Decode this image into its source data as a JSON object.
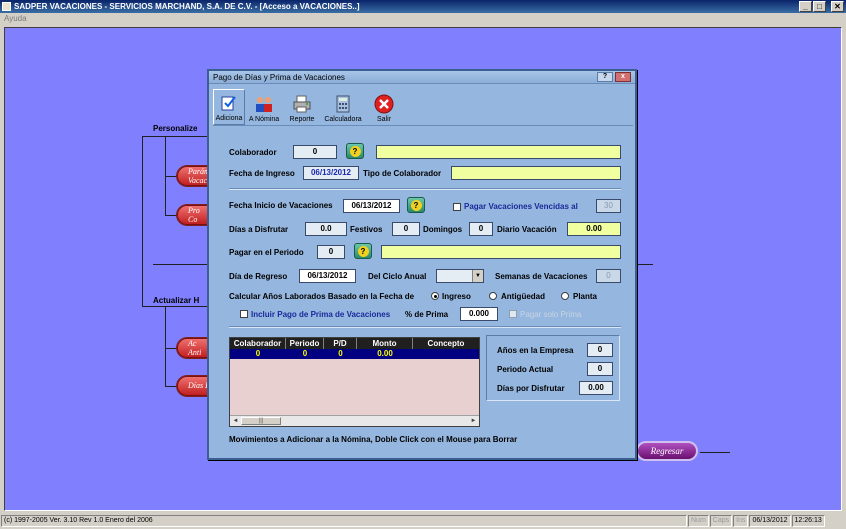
{
  "window": {
    "title": "SADPER VACACIONES  -  SERVICIOS MARCHAND, S.A. DE C.V.  -  [Acceso a VACACIONES..]",
    "min": "_",
    "max": "□",
    "close": "✕"
  },
  "menu": {
    "ayuda": "Ayuda"
  },
  "background": {
    "personalize_label": "Personalize",
    "actualizar_label": "Actualizar H",
    "pills": [
      {
        "line1": "Parám",
        "line2": "Vacac"
      },
      {
        "line1": "Pro",
        "line2": "Co"
      },
      {
        "line1": "Ac",
        "line2": "Anti"
      },
      {
        "line1": "Días D",
        "line2": ""
      }
    ],
    "regresar": "Regresar"
  },
  "dialog": {
    "title": "Pago de Días y Prima de Vacaciones",
    "help_btn": "?",
    "close_btn": "x",
    "toolbar": {
      "adiciona": "Adiciona",
      "a_nomina": "A Nómina",
      "reporte": "Reporte",
      "calculadora": "Calculadora",
      "salir": "Salir"
    },
    "q": "?",
    "colaborador_label": "Colaborador",
    "colaborador_value": "0",
    "colaborador_name": "",
    "fecha_ingreso_label": "Fecha de Ingreso",
    "fecha_ingreso_value": "06/13/2012",
    "tipo_colaborador_label": "Tipo de Colaborador",
    "tipo_colaborador_value": "",
    "fecha_inicio_label": "Fecha Inicio de Vacaciones",
    "fecha_inicio_value": "06/13/2012",
    "pagar_vencidas_label": "Pagar Vacaciones Vencidas al",
    "pagar_vencidas_value": "30",
    "dias_disfrutar_label": "Días a Disfrutar",
    "dias_disfrutar_value": "0.0",
    "festivos_label": "Festivos",
    "festivos_value": "0",
    "domingos_label": "Domingos",
    "domingos_value": "0",
    "diario_vacacion_label": "Diario Vacación",
    "diario_vacacion_value": "0.00",
    "pagar_periodo_label": "Pagar en el Periodo",
    "pagar_periodo_value": "0",
    "pagar_periodo_desc": "",
    "dia_regreso_label": "Día de Regreso",
    "dia_regreso_value": "06/13/2012",
    "ciclo_anual_label": "Del Ciclo Anual",
    "ciclo_anual_value": "",
    "semanas_label": "Semanas de Vacaciones",
    "semanas_value": "0",
    "calcular_label": "Calcular Años Laborados Basado en la Fecha de",
    "radio_ingreso": "Ingreso",
    "radio_antiguedad": "Antigüedad",
    "radio_planta": "Planta",
    "incluir_prima_label": "Incluir Pago de Prima de Vacaciones",
    "pct_prima_label": "% de Prima",
    "pct_prima_value": "0.000",
    "pagar_solo_prima_label": "Pagar solo Prima",
    "grid": {
      "columns": [
        "Colaborador",
        "Periodo",
        "P/D",
        "Monto",
        "Concepto"
      ],
      "rows": [
        [
          "0",
          "0",
          "0",
          "0.00",
          ""
        ]
      ]
    },
    "anios_empresa_label": "Años en la Empresa",
    "anios_empresa_value": "0",
    "periodo_actual_label": "Periodo Actual",
    "periodo_actual_value": "0",
    "dias_por_disfrutar_label": "Días por Disfrutar",
    "dias_por_disfrutar_value": "0.00",
    "footer": "Movimientos a Adicionar a la Nómina, Doble Click con el Mouse para Borrar"
  },
  "status": {
    "copyright": "(c) 1997-2005  Ver. 3.10 Rev 1.0  Enero del 2006",
    "num": "Num",
    "caps": "Caps",
    "ins": "Ins",
    "date": "06/13/2012",
    "time": "12:26:13"
  },
  "colors": {
    "desktop": "#8080ff",
    "dialog": "#95b6de",
    "highlight_field": "#f0ffa0",
    "grid_row": "#000080"
  }
}
